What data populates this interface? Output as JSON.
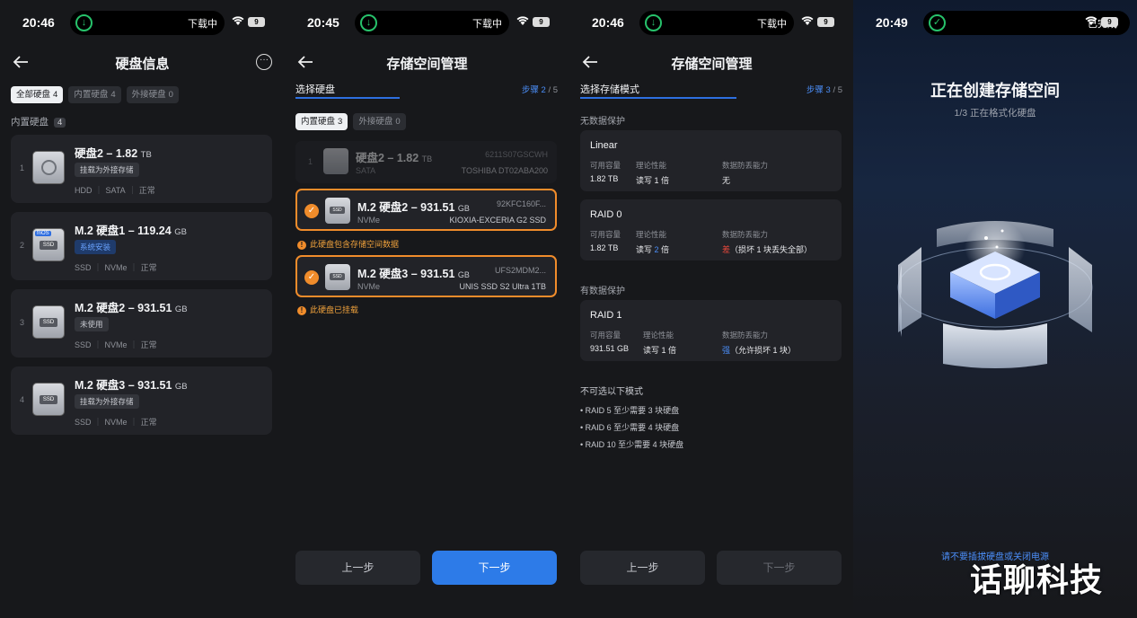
{
  "screen1": {
    "time": "20:46",
    "island_text": "下载中",
    "battery": "9",
    "title": "硬盘信息",
    "chips": [
      {
        "label": "全部硬盘",
        "count": "4"
      },
      {
        "label": "内置硬盘",
        "count": "4"
      },
      {
        "label": "外接硬盘",
        "count": "0"
      }
    ],
    "section": "内置硬盘",
    "section_count": "4",
    "disks": [
      {
        "idx": "1",
        "name": "硬盘2 – 1.82",
        "unit": "TB",
        "tag": "挂载为外接存储",
        "meta": [
          "HDD",
          "SATA",
          "正常"
        ]
      },
      {
        "idx": "2",
        "name": "M.2 硬盘1 – 119.24",
        "unit": "GB",
        "tag": "系统安装",
        "meta": [
          "SSD",
          "NVMe",
          "正常"
        ]
      },
      {
        "idx": "3",
        "name": "M.2 硬盘2 – 931.51",
        "unit": "GB",
        "tag": "未使用",
        "meta": [
          "SSD",
          "NVMe",
          "正常"
        ]
      },
      {
        "idx": "4",
        "name": "M.2 硬盘3 – 931.51",
        "unit": "GB",
        "tag": "挂载为外接存储",
        "meta": [
          "SSD",
          "NVMe",
          "正常"
        ]
      }
    ]
  },
  "screen2": {
    "time": "20:45",
    "island_text": "下载中",
    "battery": "9",
    "title": "存储空间管理",
    "step_title": "选择硬盘",
    "step_label": "步骤",
    "step_current": "2",
    "step_total": "/ 5",
    "chips": [
      {
        "label": "内置硬盘",
        "count": "3"
      },
      {
        "label": "外接硬盘",
        "count": "0"
      }
    ],
    "disks": [
      {
        "idx": "1",
        "name": "硬盘2 – 1.82",
        "unit": "TB",
        "sn": "6211S07GSCWH",
        "iface": "SATA",
        "model": "TOSHIBA DT02ABA200"
      },
      {
        "name": "M.2 硬盘2 – 931.51",
        "unit": "GB",
        "sn": "92KFC160F...",
        "iface": "NVMe",
        "model": "KIOXIA-EXCERIA G2 SSD",
        "warn": "此硬盘包含存储空间数据"
      },
      {
        "name": "M.2 硬盘3 – 931.51",
        "unit": "GB",
        "sn": "UFS2MDM2...",
        "iface": "NVMe",
        "model": "UNIS SSD S2 Ultra 1TB",
        "warn": "此硬盘已挂载"
      }
    ],
    "prev": "上一步",
    "next": "下一步"
  },
  "screen3": {
    "time": "20:46",
    "island_text": "下载中",
    "battery": "9",
    "title": "存储空间管理",
    "step_title": "选择存储模式",
    "step_label": "步骤",
    "step_current": "3",
    "step_total": "/ 5",
    "group1": "无数据保护",
    "group2": "有数据保护",
    "col_capacity": "可用容量",
    "col_perf": "理论性能",
    "col_protect": "数据防丢能力",
    "modes": [
      {
        "name": "Linear",
        "capacity": "1.82 TB",
        "perf": "读写 1 倍",
        "protect": "无"
      },
      {
        "name": "RAID 0",
        "capacity": "1.82 TB",
        "perf_pre": "读写 ",
        "perf_num": "2",
        "perf_post": " 倍",
        "protect_hl": "差",
        "protect_rest": "（损坏 1 块丢失全部）"
      },
      {
        "name": "RAID 1",
        "capacity": "931.51 GB",
        "perf": "读写 1 倍",
        "protect_hl": "强",
        "protect_rest": "（允许损坏 1 块）"
      }
    ],
    "unavailable_title": "不可选以下模式",
    "unavailable": [
      "• RAID 5 至少需要 3 块硬盘",
      "• RAID 6 至少需要 4 块硬盘",
      "• RAID 10 至少需要 4 块硬盘"
    ],
    "prev": "上一步",
    "next": "下一步"
  },
  "screen4": {
    "time": "20:49",
    "island_text": "已完成",
    "battery": "9",
    "title": "正在创建存储空间",
    "subtitle": "1/3 正在格式化硬盘",
    "hint": "请不要插拔硬盘或关闭电源"
  },
  "watermark": "话聊科技",
  "colors": {
    "accent": "#2d7be8",
    "warning": "#f08c2b",
    "danger": "#e8483c",
    "background": "#17181b",
    "card": "#222328"
  }
}
